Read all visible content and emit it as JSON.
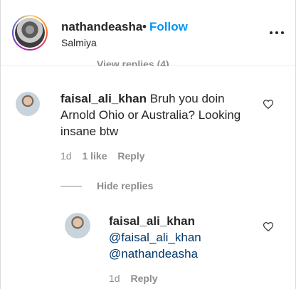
{
  "post_header": {
    "username": "nathandeasha",
    "separator": "•",
    "follow_label": "Follow",
    "location": "Salmiya",
    "more_icon": "more-horizontal-icon"
  },
  "cut_text": "View replies (4)",
  "comment": {
    "username": "faisal_ali_khan",
    "text": "Bruh you doin Arnold Ohio or Australia? Looking insane btw",
    "age": "1d",
    "likes": "1 like",
    "reply_label": "Reply"
  },
  "hide_replies_label": "Hide replies",
  "reply": {
    "username": "faisal_ali_khan",
    "line1": "@faisal_ali_khan",
    "line2": "@nathandeasha",
    "age": "1d",
    "reply_label": "Reply"
  },
  "colors": {
    "text": "#262626",
    "secondary": "#8e8e8e",
    "follow_blue": "#0095f6",
    "border": "#dbdbdb"
  }
}
